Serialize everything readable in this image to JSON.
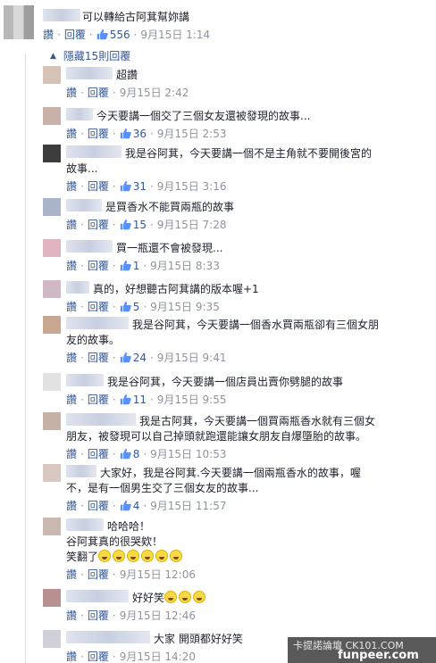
{
  "top_comment": {
    "text": "可以轉給古阿萁幫妳講",
    "read": "讚",
    "reply": "回覆",
    "likes": "556",
    "time": "9月15日 1:14"
  },
  "hide_replies": "隱藏15則回覆",
  "replies": [
    {
      "lines": [
        "超讚"
      ],
      "read": "讚",
      "reply": "回覆",
      "likes": "",
      "time": "9月15日 2:42"
    },
    {
      "lines": [
        "今天要講一個交了三個女友還被發現的故事..."
      ],
      "read": "讚",
      "reply": "回覆",
      "likes": "36",
      "time": "9月15日 2:53"
    },
    {
      "lines": [
        "我是谷阿萁，今天要講一個不是主角就不要開後宮的",
        "故事..."
      ],
      "read": "讚",
      "reply": "回覆",
      "likes": "31",
      "time": "9月15日 3:16"
    },
    {
      "lines": [
        "是買香水不能買兩瓶的故事"
      ],
      "read": "讚",
      "reply": "回覆",
      "likes": "15",
      "time": "9月15日 7:28"
    },
    {
      "lines": [
        "買一瓶還不會被發現..."
      ],
      "read": "讚",
      "reply": "回覆",
      "likes": "1",
      "time": "9月15日 8:33"
    },
    {
      "lines": [
        "真的，好想聽古阿萁講的版本喔+1"
      ],
      "read": "讚",
      "reply": "回覆",
      "likes": "5",
      "time": "9月15日 9:35"
    },
    {
      "lines": [
        "我是谷阿萁，今天要講一個香水買兩瓶卻有三個女朋",
        "友的故事。"
      ],
      "read": "讚",
      "reply": "回覆",
      "likes": "24",
      "time": "9月15日 9:41"
    },
    {
      "lines": [
        "我是谷阿萁，今天要講一個店員出賣你劈腿的故事"
      ],
      "read": "讚",
      "reply": "回覆",
      "likes": "11",
      "time": "9月15日 9:55"
    },
    {
      "lines": [
        "我是古阿萁，今天要講一個買兩瓶香水就有三個女",
        "朋友，被發現可以自己掉頭就跑還能讓女朋友自爆墮胎的故事。"
      ],
      "read": "讚",
      "reply": "回覆",
      "likes": "8",
      "time": "9月15日 10:53"
    },
    {
      "lines": [
        "大家好，我是谷阿萁.今天要講一個兩瓶香水的故事，喔",
        "不，是有一個男生交了三個女友的故事..."
      ],
      "read": "讚",
      "reply": "回覆",
      "likes": "4",
      "time": "9月15日 11:57"
    },
    {
      "lines": [
        "哈哈哈！",
        "谷阿萁真的很哭欸！",
        "笑翻了"
      ],
      "read": "讚",
      "reply": "回覆",
      "likes": "",
      "time": "9月15日 12:06"
    },
    {
      "lines": [
        "好好笑"
      ],
      "read": "讚",
      "reply": "回覆",
      "likes": "",
      "time": "9月15日 12:46"
    },
    {
      "lines": [
        "大家 開頭都好好笑"
      ],
      "read": "讚",
      "reply": "回覆",
      "likes": "",
      "time": "9月15日 14:20"
    }
  ],
  "watermark": {
    "line1": "卡提諾論壇 CK101.COM",
    "line2": "funpeer.com"
  }
}
